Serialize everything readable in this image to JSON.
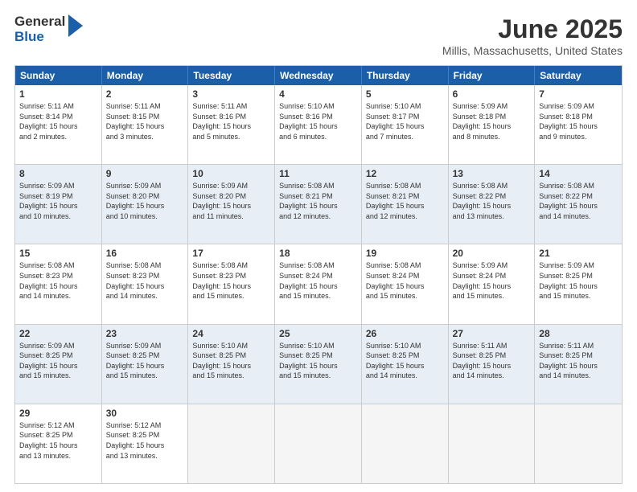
{
  "header": {
    "logo_general": "General",
    "logo_blue": "Blue",
    "month_title": "June 2025",
    "location": "Millis, Massachusetts, United States"
  },
  "days_of_week": [
    "Sunday",
    "Monday",
    "Tuesday",
    "Wednesday",
    "Thursday",
    "Friday",
    "Saturday"
  ],
  "weeks": [
    [
      {
        "day": "1",
        "info": "Sunrise: 5:11 AM\nSunset: 8:14 PM\nDaylight: 15 hours\nand 2 minutes.",
        "empty": false,
        "shaded": false
      },
      {
        "day": "2",
        "info": "Sunrise: 5:11 AM\nSunset: 8:15 PM\nDaylight: 15 hours\nand 3 minutes.",
        "empty": false,
        "shaded": false
      },
      {
        "day": "3",
        "info": "Sunrise: 5:11 AM\nSunset: 8:16 PM\nDaylight: 15 hours\nand 5 minutes.",
        "empty": false,
        "shaded": false
      },
      {
        "day": "4",
        "info": "Sunrise: 5:10 AM\nSunset: 8:16 PM\nDaylight: 15 hours\nand 6 minutes.",
        "empty": false,
        "shaded": false
      },
      {
        "day": "5",
        "info": "Sunrise: 5:10 AM\nSunset: 8:17 PM\nDaylight: 15 hours\nand 7 minutes.",
        "empty": false,
        "shaded": false
      },
      {
        "day": "6",
        "info": "Sunrise: 5:09 AM\nSunset: 8:18 PM\nDaylight: 15 hours\nand 8 minutes.",
        "empty": false,
        "shaded": false
      },
      {
        "day": "7",
        "info": "Sunrise: 5:09 AM\nSunset: 8:18 PM\nDaylight: 15 hours\nand 9 minutes.",
        "empty": false,
        "shaded": false
      }
    ],
    [
      {
        "day": "8",
        "info": "Sunrise: 5:09 AM\nSunset: 8:19 PM\nDaylight: 15 hours\nand 10 minutes.",
        "empty": false,
        "shaded": true
      },
      {
        "day": "9",
        "info": "Sunrise: 5:09 AM\nSunset: 8:20 PM\nDaylight: 15 hours\nand 10 minutes.",
        "empty": false,
        "shaded": true
      },
      {
        "day": "10",
        "info": "Sunrise: 5:09 AM\nSunset: 8:20 PM\nDaylight: 15 hours\nand 11 minutes.",
        "empty": false,
        "shaded": true
      },
      {
        "day": "11",
        "info": "Sunrise: 5:08 AM\nSunset: 8:21 PM\nDaylight: 15 hours\nand 12 minutes.",
        "empty": false,
        "shaded": true
      },
      {
        "day": "12",
        "info": "Sunrise: 5:08 AM\nSunset: 8:21 PM\nDaylight: 15 hours\nand 12 minutes.",
        "empty": false,
        "shaded": true
      },
      {
        "day": "13",
        "info": "Sunrise: 5:08 AM\nSunset: 8:22 PM\nDaylight: 15 hours\nand 13 minutes.",
        "empty": false,
        "shaded": true
      },
      {
        "day": "14",
        "info": "Sunrise: 5:08 AM\nSunset: 8:22 PM\nDaylight: 15 hours\nand 14 minutes.",
        "empty": false,
        "shaded": true
      }
    ],
    [
      {
        "day": "15",
        "info": "Sunrise: 5:08 AM\nSunset: 8:23 PM\nDaylight: 15 hours\nand 14 minutes.",
        "empty": false,
        "shaded": false
      },
      {
        "day": "16",
        "info": "Sunrise: 5:08 AM\nSunset: 8:23 PM\nDaylight: 15 hours\nand 14 minutes.",
        "empty": false,
        "shaded": false
      },
      {
        "day": "17",
        "info": "Sunrise: 5:08 AM\nSunset: 8:23 PM\nDaylight: 15 hours\nand 15 minutes.",
        "empty": false,
        "shaded": false
      },
      {
        "day": "18",
        "info": "Sunrise: 5:08 AM\nSunset: 8:24 PM\nDaylight: 15 hours\nand 15 minutes.",
        "empty": false,
        "shaded": false
      },
      {
        "day": "19",
        "info": "Sunrise: 5:08 AM\nSunset: 8:24 PM\nDaylight: 15 hours\nand 15 minutes.",
        "empty": false,
        "shaded": false
      },
      {
        "day": "20",
        "info": "Sunrise: 5:09 AM\nSunset: 8:24 PM\nDaylight: 15 hours\nand 15 minutes.",
        "empty": false,
        "shaded": false
      },
      {
        "day": "21",
        "info": "Sunrise: 5:09 AM\nSunset: 8:25 PM\nDaylight: 15 hours\nand 15 minutes.",
        "empty": false,
        "shaded": false
      }
    ],
    [
      {
        "day": "22",
        "info": "Sunrise: 5:09 AM\nSunset: 8:25 PM\nDaylight: 15 hours\nand 15 minutes.",
        "empty": false,
        "shaded": true
      },
      {
        "day": "23",
        "info": "Sunrise: 5:09 AM\nSunset: 8:25 PM\nDaylight: 15 hours\nand 15 minutes.",
        "empty": false,
        "shaded": true
      },
      {
        "day": "24",
        "info": "Sunrise: 5:10 AM\nSunset: 8:25 PM\nDaylight: 15 hours\nand 15 minutes.",
        "empty": false,
        "shaded": true
      },
      {
        "day": "25",
        "info": "Sunrise: 5:10 AM\nSunset: 8:25 PM\nDaylight: 15 hours\nand 15 minutes.",
        "empty": false,
        "shaded": true
      },
      {
        "day": "26",
        "info": "Sunrise: 5:10 AM\nSunset: 8:25 PM\nDaylight: 15 hours\nand 14 minutes.",
        "empty": false,
        "shaded": true
      },
      {
        "day": "27",
        "info": "Sunrise: 5:11 AM\nSunset: 8:25 PM\nDaylight: 15 hours\nand 14 minutes.",
        "empty": false,
        "shaded": true
      },
      {
        "day": "28",
        "info": "Sunrise: 5:11 AM\nSunset: 8:25 PM\nDaylight: 15 hours\nand 14 minutes.",
        "empty": false,
        "shaded": true
      }
    ],
    [
      {
        "day": "29",
        "info": "Sunrise: 5:12 AM\nSunset: 8:25 PM\nDaylight: 15 hours\nand 13 minutes.",
        "empty": false,
        "shaded": false
      },
      {
        "day": "30",
        "info": "Sunrise: 5:12 AM\nSunset: 8:25 PM\nDaylight: 15 hours\nand 13 minutes.",
        "empty": false,
        "shaded": false
      },
      {
        "day": "",
        "info": "",
        "empty": true,
        "shaded": false
      },
      {
        "day": "",
        "info": "",
        "empty": true,
        "shaded": false
      },
      {
        "day": "",
        "info": "",
        "empty": true,
        "shaded": false
      },
      {
        "day": "",
        "info": "",
        "empty": true,
        "shaded": false
      },
      {
        "day": "",
        "info": "",
        "empty": true,
        "shaded": false
      }
    ]
  ]
}
